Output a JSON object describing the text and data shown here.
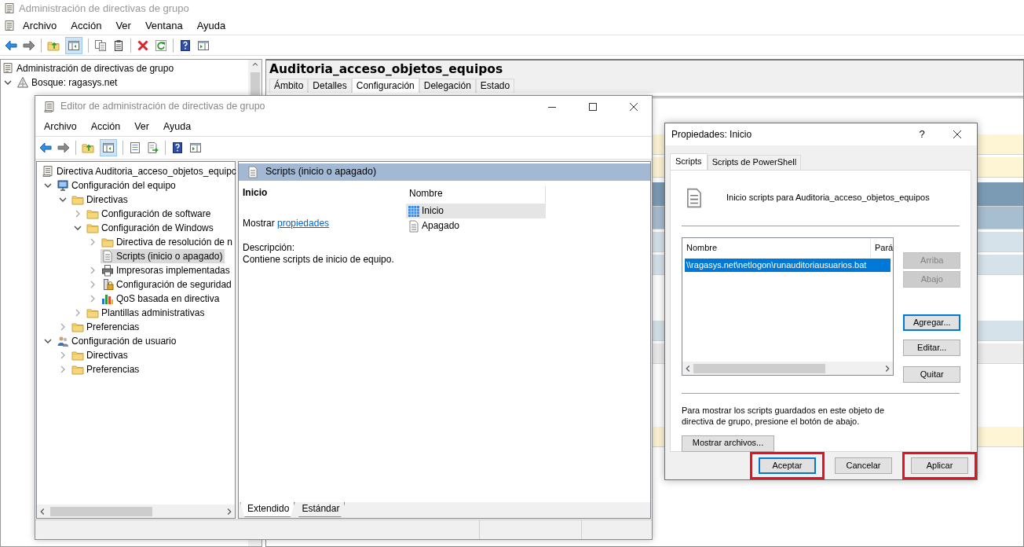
{
  "window": {
    "title": "Administración de directivas de grupo",
    "menu": [
      "Archivo",
      "Acción",
      "Ver",
      "Ventana",
      "Ayuda"
    ]
  },
  "tree": [
    {
      "label": "Administración de directivas de grupo",
      "kind": "console",
      "expandable": false,
      "selected": false,
      "children": [
        {
          "label": "Bosque: ragasys.net",
          "kind": "forest",
          "expandable": true,
          "expanded": true,
          "selected": false
        }
      ]
    }
  ],
  "gpo_panel": {
    "title": "Auditoria_acceso_objetos_equipos",
    "tabs": [
      {
        "label": "Ámbito",
        "selected": false
      },
      {
        "label": "Detalles",
        "selected": false
      },
      {
        "label": "Configuración",
        "selected": true
      },
      {
        "label": "Delegación",
        "selected": false
      },
      {
        "label": "Estado",
        "selected": false
      }
    ]
  },
  "editor": {
    "title": "Editor de administración de directivas de grupo",
    "menu": [
      "Archivo",
      "Acción",
      "Ver",
      "Ayuda"
    ],
    "tree": [
      {
        "label": "Directiva Auditoria_acceso_objetos_equipc",
        "kind": "policy",
        "expandable": false,
        "selected": false,
        "children": [
          {
            "label": "Configuración del equipo",
            "kind": "computer",
            "expandable": true,
            "expanded": true,
            "selected": false,
            "children": [
              {
                "label": "Directivas",
                "kind": "folder",
                "expandable": true,
                "expanded": true,
                "selected": false,
                "children": [
                  {
                    "label": "Configuración de software",
                    "kind": "folder",
                    "expandable": true,
                    "expanded": false,
                    "selected": false
                  },
                  {
                    "label": "Configuración de Windows",
                    "kind": "folder",
                    "expandable": true,
                    "expanded": true,
                    "selected": false,
                    "children": [
                      {
                        "label": "Directiva de resolución de n",
                        "kind": "folder",
                        "expandable": true,
                        "expanded": false,
                        "selected": false
                      },
                      {
                        "label": "Scripts (inicio o apagado)",
                        "kind": "script",
                        "expandable": false,
                        "selected": true
                      },
                      {
                        "label": "Impresoras implementadas",
                        "kind": "printer",
                        "expandable": true,
                        "expanded": false,
                        "selected": false
                      },
                      {
                        "label": "Configuración de seguridad",
                        "kind": "security",
                        "expandable": true,
                        "expanded": false,
                        "selected": false
                      },
                      {
                        "label": "QoS basada en directiva",
                        "kind": "chart",
                        "expandable": true,
                        "expanded": false,
                        "selected": false
                      }
                    ]
                  },
                  {
                    "label": "Plantillas administrativas",
                    "kind": "folder",
                    "expandable": true,
                    "expanded": false,
                    "selected": false
                  }
                ]
              },
              {
                "label": "Preferencias",
                "kind": "folder",
                "expandable": true,
                "expanded": false,
                "selected": false
              }
            ]
          },
          {
            "label": "Configuración de usuario",
            "kind": "user",
            "expandable": true,
            "expanded": true,
            "selected": false,
            "children": [
              {
                "label": "Directivas",
                "kind": "folder",
                "expandable": true,
                "expanded": false,
                "selected": false
              },
              {
                "label": "Preferencias",
                "kind": "folder",
                "expandable": true,
                "expanded": false,
                "selected": false
              }
            ]
          }
        ]
      }
    ],
    "details": {
      "header": "Scripts (inicio o apagado)",
      "item_title": "Inicio",
      "link_prefix": "Mostrar",
      "link": "propiedades",
      "description_label": "Descripción:",
      "description": "Contiene scripts de inicio de equipo.",
      "list_column": "Nombre",
      "list_items": [
        {
          "label": "Inicio",
          "kind": "startup",
          "selected": true
        },
        {
          "label": "Apagado",
          "kind": "shutdown",
          "selected": false
        }
      ]
    },
    "view_tabs": [
      {
        "label": "Extendido",
        "selected": true
      },
      {
        "label": "Estándar",
        "selected": false
      }
    ]
  },
  "dialog": {
    "title": "Propiedades: Inicio",
    "help_glyph": "?",
    "tabs": [
      {
        "label": "Scripts",
        "selected": true
      },
      {
        "label": "Scripts de PowerShell",
        "selected": false
      }
    ],
    "heading": "Inicio scripts para Auditoria_acceso_objetos_equipos",
    "columns": [
      "Nombre",
      "Pará"
    ],
    "rows": [
      {
        "name": "\\\\ragasys.net\\netlogon\\runauditoriausuarios.bat",
        "selected": true
      }
    ],
    "side_buttons": [
      {
        "label": "Arriba",
        "disabled": true,
        "focused": false
      },
      {
        "label": "Abajo",
        "disabled": true,
        "focused": false
      },
      {
        "label": "Agregar...",
        "disabled": false,
        "focused": true
      },
      {
        "label": "Editar...",
        "disabled": false,
        "focused": false
      },
      {
        "label": "Quitar",
        "disabled": false,
        "focused": false
      }
    ],
    "note": "Para mostrar los scripts guardados en este objeto de directiva de grupo, presione el botón de abajo.",
    "show_files_button": "Mostrar archivos...",
    "footer_buttons": [
      {
        "label": "Aceptar",
        "default": true,
        "highlighted": true
      },
      {
        "label": "Cancelar",
        "default": false,
        "highlighted": false
      },
      {
        "label": "Aplicar",
        "default": false,
        "highlighted": true
      }
    ]
  }
}
